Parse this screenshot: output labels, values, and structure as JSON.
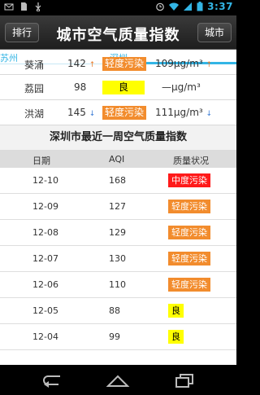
{
  "status_bar": {
    "time": "3:37"
  },
  "header": {
    "left_button": "排行",
    "title": "城市空气质量指数",
    "right_button": "城市"
  },
  "city_tabs": [
    "苏州",
    "深圳"
  ],
  "stations": [
    {
      "name": "葵涌",
      "aqi": "142",
      "aqi_trend": "up",
      "level": "轻度污染",
      "level_color": "#f28c2d",
      "pm": "109μg/m³",
      "pm_trend": "up"
    },
    {
      "name": "荔园",
      "aqi": "98",
      "aqi_trend": "",
      "level": "良",
      "level_color": "#ffff00",
      "pm": "—μg/m³",
      "pm_trend": ""
    },
    {
      "name": "洪湖",
      "aqi": "145",
      "aqi_trend": "down",
      "level": "轻度污染",
      "level_color": "#f28c2d",
      "pm": "111μg/m³",
      "pm_trend": "down"
    }
  ],
  "week_section": {
    "title": "深圳市最近一周空气质量指数",
    "columns": [
      "日期",
      "AQI",
      "质量状况"
    ],
    "rows": [
      {
        "date": "12-10",
        "aqi": "168",
        "level": "中度污染",
        "level_color": "#ff1a1a",
        "text_color": "#ffffff"
      },
      {
        "date": "12-09",
        "aqi": "127",
        "level": "轻度污染",
        "level_color": "#f28c2d",
        "text_color": "#ffffff"
      },
      {
        "date": "12-08",
        "aqi": "129",
        "level": "轻度污染",
        "level_color": "#f28c2d",
        "text_color": "#ffffff"
      },
      {
        "date": "12-07",
        "aqi": "130",
        "level": "轻度污染",
        "level_color": "#f28c2d",
        "text_color": "#ffffff"
      },
      {
        "date": "12-06",
        "aqi": "110",
        "level": "轻度污染",
        "level_color": "#f28c2d",
        "text_color": "#ffffff"
      },
      {
        "date": "12-05",
        "aqi": "88",
        "level": "良",
        "level_color": "#ffff00",
        "text_color": "#000000"
      },
      {
        "date": "12-04",
        "aqi": "99",
        "level": "良",
        "level_color": "#ffff00",
        "text_color": "#000000"
      }
    ]
  },
  "nav_bar": {
    "icons": [
      "back-icon",
      "home-icon",
      "recent-apps-icon"
    ]
  }
}
